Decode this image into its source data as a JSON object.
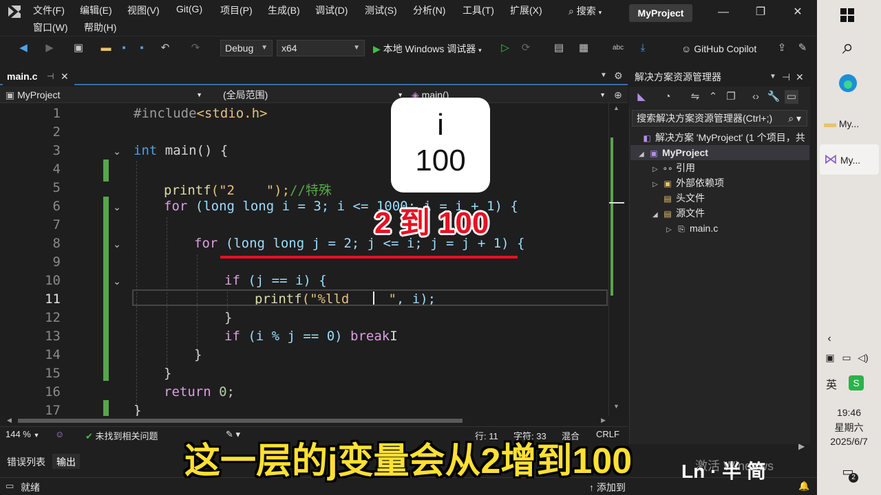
{
  "menu": [
    "文件(F)",
    "编辑(E)",
    "视图(V)",
    "Git(G)",
    "项目(P)",
    "生成(B)",
    "调试(D)",
    "测试(S)",
    "分析(N)",
    "工具(T)",
    "扩展(X)",
    "窗口(W)",
    "帮助(H)"
  ],
  "search_label": "搜索",
  "project_badge": "MyProject",
  "toolbar": {
    "config": "Debug",
    "platform": "x64",
    "run_label": "本地 Windows 调试器",
    "copilot": "GitHub Copilot"
  },
  "editor": {
    "tab_label": "main.c",
    "nav_project": "MyProject",
    "nav_scope": "(全局范围)",
    "nav_member": "main()",
    "active_line": "11"
  },
  "code_lines": [
    {
      "n": "1"
    },
    {
      "n": "2"
    },
    {
      "n": "3"
    },
    {
      "n": "4"
    },
    {
      "n": "5"
    },
    {
      "n": "6"
    },
    {
      "n": "7"
    },
    {
      "n": "8"
    },
    {
      "n": "9"
    },
    {
      "n": "10"
    },
    {
      "n": "11"
    },
    {
      "n": "12"
    },
    {
      "n": "13"
    },
    {
      "n": "14"
    },
    {
      "n": "15"
    },
    {
      "n": "16"
    },
    {
      "n": "17"
    }
  ],
  "code": {
    "l1_a": "#include",
    "l1_b": "<stdio.h>",
    "l3_kw": "int",
    "l3_rest": " main() {",
    "l5_fn": "printf",
    "l5_str": "(\"2    \");",
    "l5_cm": "//特殊",
    "l6_kw": "for",
    "l6_rest": " (long long i = 3; i <= 1000; i = i + 1) {",
    "l8_kw": "for",
    "l8_rest": " (long long j = 2; j <= i; j = j + 1) {",
    "l10_kw": "if",
    "l10_rest": " (j == i) {",
    "l11_fn": "printf",
    "l11_str": "(\"%lld     \"",
    "l11_rest": ", i);",
    "l12": "}",
    "l13_kw": "if",
    "l13_rest": " (i % j == 0) ",
    "l13_brk": "break",
    "l14": "}",
    "l15": "}",
    "l16_kw": "return",
    "l16_rest": " 0;",
    "l17": "}"
  },
  "overlay": {
    "var_name": "i",
    "var_value": "100",
    "range": "2 到 100",
    "subtitle": "这一层的j变量会从2增到100"
  },
  "editor_status": {
    "zoom": "144 %",
    "issues": "未找到相关问题",
    "line": "行: 11",
    "char": "字符: 33",
    "mode": "混合",
    "eol": "CRLF"
  },
  "bottom_tabs": [
    "错误列表",
    "输出"
  ],
  "status_ready": "就绪",
  "status_add": "添加到",
  "solution": {
    "title": "解决方案资源管理器",
    "search": "搜索解决方案资源管理器(Ctrl+;)",
    "root": "解决方案 'MyProject' (1 个项目，共",
    "project": "MyProject",
    "items": [
      "引用",
      "外部依赖项",
      "头文件",
      "源文件",
      "main.c"
    ]
  },
  "taskbar": {
    "app1": "My...",
    "app2": "My...",
    "time": "19:46",
    "weekday": "星期六",
    "date": "2025/6/7",
    "ime": "英",
    "notif": "2"
  },
  "watermark": [
    "激活 Windows",
    "Ln",
    "半",
    "简"
  ]
}
